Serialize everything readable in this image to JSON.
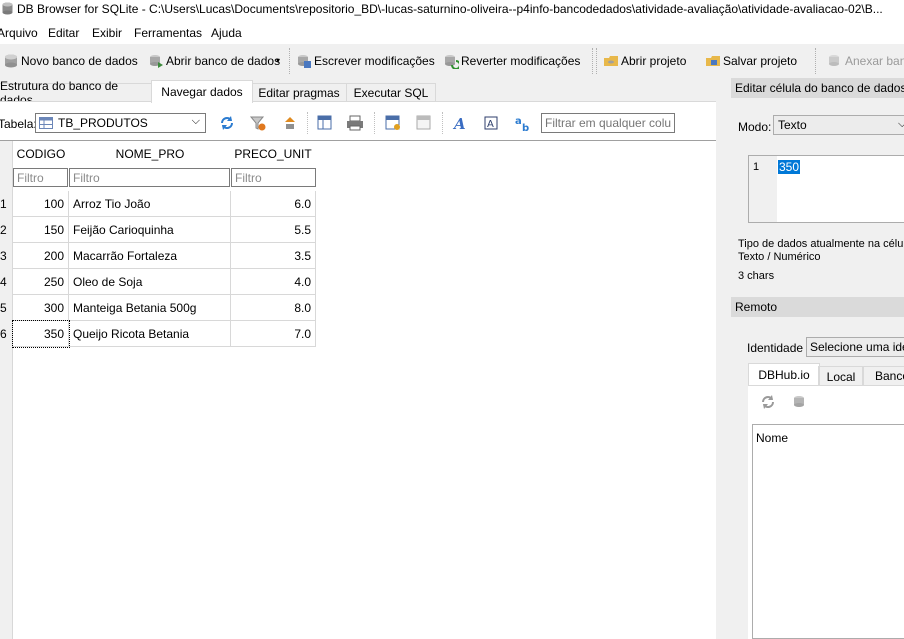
{
  "window": {
    "title": "DB Browser for SQLite - C:\\Users\\Lucas\\Documents\\repositorio_BD\\-lucas-saturnino-oliveira--p4info-bancodedados\\atividade-avaliação\\atividade-avaliacao-02\\B..."
  },
  "menu": [
    "Arquivo",
    "Editar",
    "Exibir",
    "Ferramentas",
    "Ajuda"
  ],
  "toolbar": {
    "new_db": "Novo banco de dados",
    "open_db": "Abrir banco de dados",
    "write": "Escrever modificações",
    "revert": "Reverter modificações",
    "open_project": "Abrir projeto",
    "save_project": "Salvar projeto",
    "attach": "Anexar banco"
  },
  "tabs": [
    "Estrutura do banco de dados",
    "Navegar dados",
    "Editar pragmas",
    "Executar SQL"
  ],
  "browse": {
    "table_label": "Tabela:",
    "table_selected": "TB_PRODUTOS",
    "filter_placeholder": "Filtrar em qualquer coluna",
    "columns": [
      "CODIGO",
      "NOME_PRO",
      "PRECO_UNIT"
    ],
    "filter_text": "Filtro",
    "rows": [
      {
        "n": "1",
        "codigo": "100",
        "nome": "Arroz Tio João",
        "preco": "6.0"
      },
      {
        "n": "2",
        "codigo": "150",
        "nome": "Feijão Carioquinha",
        "preco": "5.5"
      },
      {
        "n": "3",
        "codigo": "200",
        "nome": "Macarrão Fortaleza",
        "preco": "3.5"
      },
      {
        "n": "4",
        "codigo": "250",
        "nome": "Oleo de Soja",
        "preco": "4.0"
      },
      {
        "n": "5",
        "codigo": "300",
        "nome": "Manteiga Betania 500g",
        "preco": "8.0"
      },
      {
        "n": "6",
        "codigo": "350",
        "nome": "Queijo Ricota Betania",
        "preco": "7.0"
      }
    ]
  },
  "edit_cell": {
    "title": "Editar célula do banco de dados",
    "mode_label": "Modo:",
    "mode_value": "Texto",
    "line_number": "1",
    "value": "350",
    "type_label": "Tipo de dados atualmente na célula",
    "type_value": "Texto / Numérico",
    "size": "3 chars"
  },
  "remote": {
    "title": "Remoto",
    "identity_label": "Identidade",
    "identity_value": "Selecione uma identidade",
    "tabs": [
      "DBHub.io",
      "Local",
      "Banco"
    ],
    "name_header": "Nome"
  },
  "colors": {
    "selection": "#0078d7",
    "accent": "#1e73be"
  }
}
